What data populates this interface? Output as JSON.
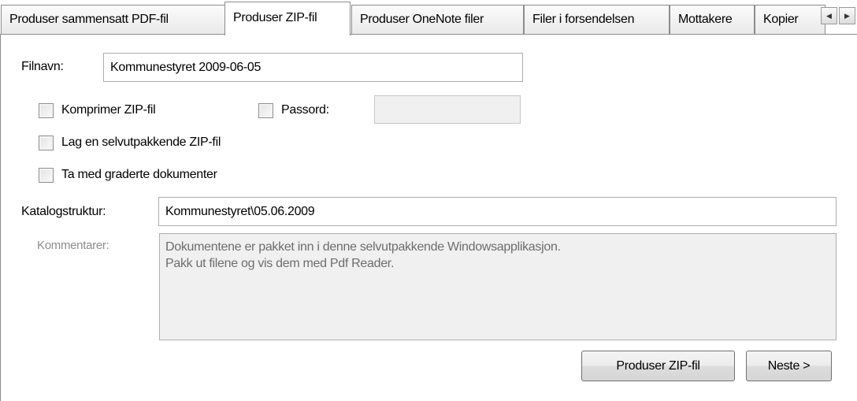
{
  "tabs": [
    {
      "label": "Produser sammensatt PDF-fil"
    },
    {
      "label": "Produser ZIP-fil"
    },
    {
      "label": "Produser OneNote filer"
    },
    {
      "label": "Filer i forsendelsen"
    },
    {
      "label": "Mottakere"
    },
    {
      "label": "Kopier"
    }
  ],
  "tab_scroll": {
    "left": "◀",
    "right": "▶"
  },
  "form": {
    "filename_label": "Filnavn:",
    "filename_value": "Kommunestyret 2009-06-05",
    "compress_label": "Komprimer ZIP-fil",
    "compress_checked": false,
    "password_label": "Passord:",
    "password_value": "",
    "selfextract_label": "Lag en selvutpakkende ZIP-fil",
    "selfextract_checked": false,
    "graded_label": "Ta med graderte dokumenter",
    "graded_checked": false,
    "catalog_label": "Katalogstruktur:",
    "catalog_value": "Kommunestyret\\05.06.2009",
    "comments_label": "Kommentarer:",
    "comments_line1": "Dokumentene er pakket inn i denne selvutpakkende Windowsapplikasjon.",
    "comments_line2": "Pakk ut filene og vis dem med Pdf Reader."
  },
  "buttons": {
    "produce_zip": "Produser ZIP-fil",
    "next": "Neste >"
  }
}
